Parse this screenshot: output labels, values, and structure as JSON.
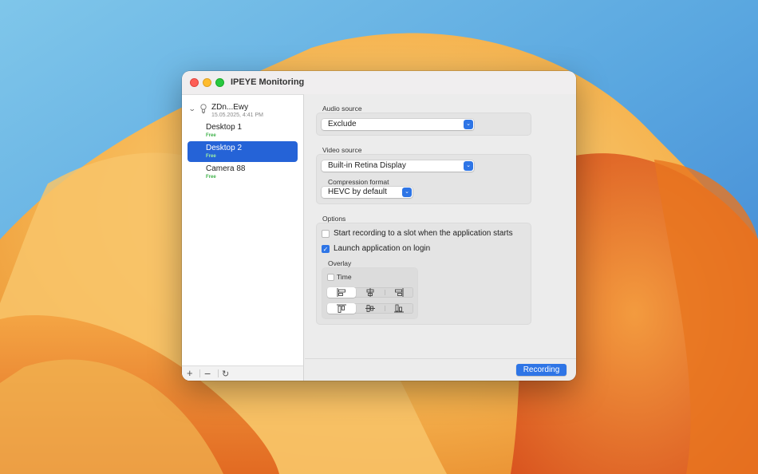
{
  "window": {
    "title": "IPEYE Monitoring"
  },
  "sidebar": {
    "group": {
      "name": "ZDn...Ewy",
      "date": "15.05.2025, 4:41 PM"
    },
    "slots": [
      {
        "name": "Desktop 1",
        "status": "Free",
        "selected": false
      },
      {
        "name": "Desktop 2",
        "status": "Free",
        "selected": true
      },
      {
        "name": "Camera 88",
        "status": "Free",
        "selected": false
      }
    ],
    "toolbar": {
      "add": "+",
      "remove": "−",
      "refresh": "↻"
    }
  },
  "audio": {
    "label": "Audio source",
    "value": "Exclude"
  },
  "video": {
    "label": "Video source",
    "value": "Built-in Retina Display",
    "compression_label": "Compression format",
    "compression_value": "HEVC by default"
  },
  "options": {
    "label": "Options",
    "start_recording": {
      "label": "Start recording to a slot when the application starts",
      "checked": false
    },
    "launch_on_login": {
      "label": "Launch application on login",
      "checked": true
    },
    "overlay": {
      "label": "Overlay",
      "time": {
        "label": "Time",
        "checked": false
      },
      "horizontal_alignment": [
        "align-left-icon",
        "align-center-icon",
        "align-right-icon"
      ],
      "horizontal_selected": 0,
      "vertical_alignment": [
        "align-top-icon",
        "align-middle-icon",
        "align-bottom-icon"
      ],
      "vertical_selected": 0
    }
  },
  "footer": {
    "record_button": "Recording"
  },
  "colors": {
    "accent": "#2e75e6",
    "selection": "#2563d7",
    "free_status": "#3fb24a"
  }
}
